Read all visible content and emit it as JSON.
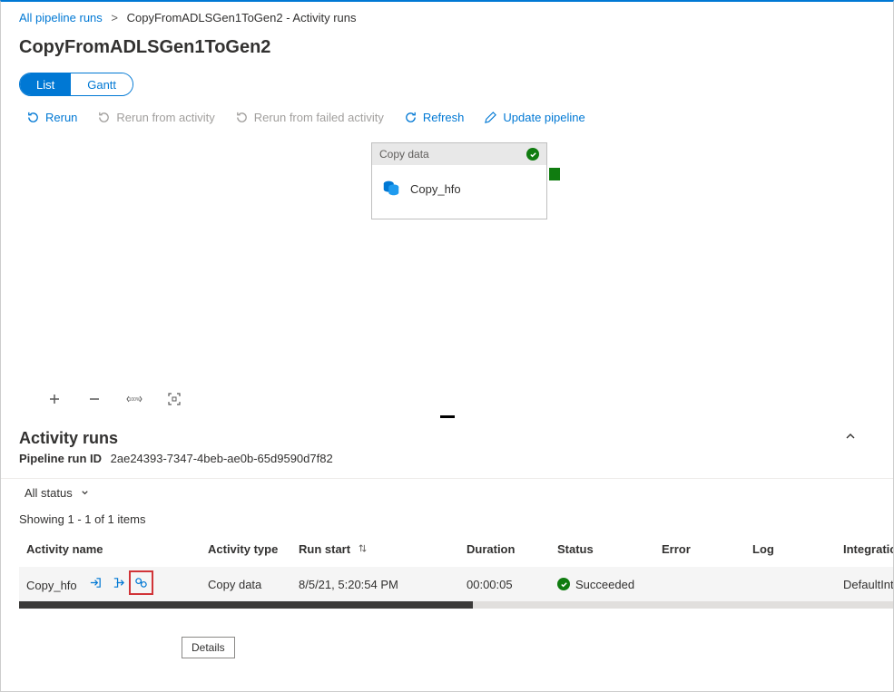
{
  "breadcrumb": {
    "root": "All pipeline runs",
    "current": "CopyFromADLSGen1ToGen2 - Activity runs"
  },
  "title": "CopyFromADLSGen1ToGen2",
  "viewToggle": {
    "list": "List",
    "gantt": "Gantt"
  },
  "toolbar": {
    "rerun": "Rerun",
    "rerun_activity": "Rerun from activity",
    "rerun_failed": "Rerun from failed activity",
    "refresh": "Refresh",
    "update": "Update pipeline"
  },
  "node": {
    "type_label": "Copy data",
    "name": "Copy_hfo"
  },
  "section": {
    "heading": "Activity runs",
    "runid_label": "Pipeline run ID",
    "runid_value": "2ae24393-7347-4beb-ae0b-65d9590d7f82"
  },
  "filter": {
    "all_status": "All status"
  },
  "showing": "Showing 1 - 1 of 1 items",
  "columns": {
    "name": "Activity name",
    "type": "Activity type",
    "start": "Run start",
    "duration": "Duration",
    "status": "Status",
    "error": "Error",
    "log": "Log",
    "integration": "Integration r"
  },
  "row": {
    "name": "Copy_hfo",
    "type": "Copy data",
    "start": "8/5/21, 5:20:54 PM",
    "duration": "00:00:05",
    "status": "Succeeded",
    "integration": "DefaultInteg"
  },
  "tooltip_details": "Details"
}
